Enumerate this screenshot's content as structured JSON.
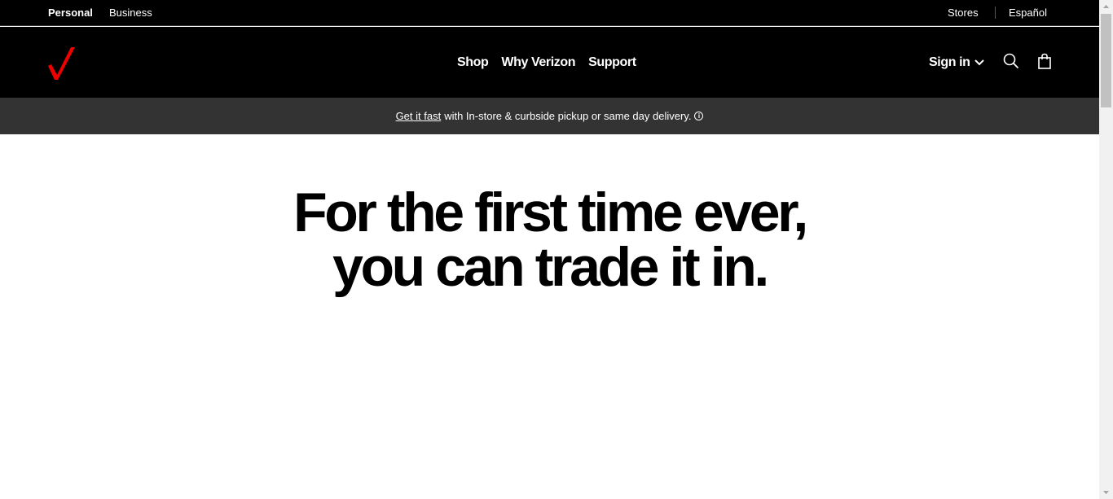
{
  "utility_bar": {
    "personal": "Personal",
    "business": "Business",
    "stores": "Stores",
    "espanol": "Español"
  },
  "brand": {
    "logo_icon": "verizon-checkmark-icon",
    "accent_color": "#ee0000"
  },
  "nav": {
    "items": [
      {
        "label": "Shop"
      },
      {
        "label": "Why Verizon"
      },
      {
        "label": "Support"
      }
    ],
    "signin_label": "Sign in",
    "signin_icon": "chevron-down-icon",
    "search_icon": "search-icon",
    "cart_icon": "shopping-bag-icon"
  },
  "promo": {
    "link_text": "Get it fast",
    "text": "with In-store & curbside pickup or same day delivery.",
    "info_icon": "info-icon",
    "info_glyph": "i"
  },
  "hero": {
    "line1": "For the first time ever,",
    "line2": "you can trade it in."
  },
  "colors": {
    "header_bg": "#000000",
    "promo_bg": "#333333",
    "page_bg": "#ffffff",
    "text_on_dark": "#ffffff"
  }
}
